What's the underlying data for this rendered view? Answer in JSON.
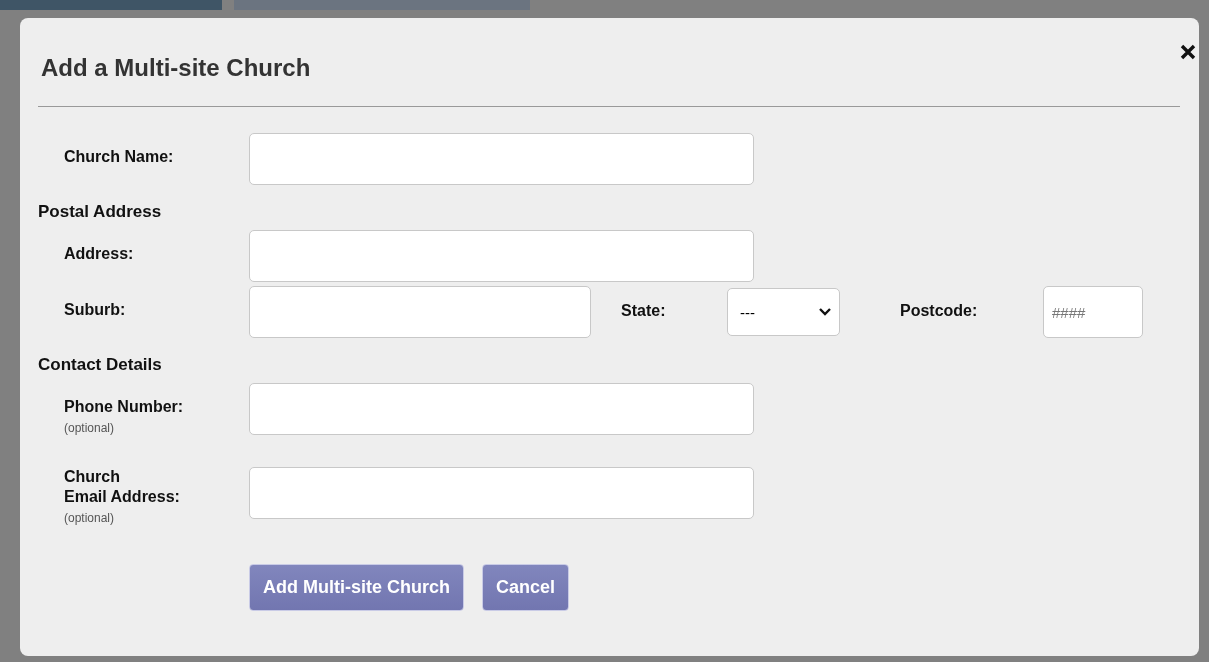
{
  "dialog": {
    "title": "Add a Multi-site Church"
  },
  "rows": [
    {
      "kind": "text",
      "label_lines": [
        "Church Name:"
      ]
    },
    {
      "kind": "heading",
      "text": "Postal Address"
    },
    {
      "kind": "text",
      "label_lines": [
        "Address:"
      ]
    },
    {
      "kind": "inline",
      "items": [
        {
          "kind": "text",
          "label_lines": [
            "Suburb:"
          ]
        },
        {
          "kind": "select",
          "label_lines": [
            "State:"
          ],
          "value": "---"
        },
        {
          "kind": "text",
          "label_lines": [
            "Postcode:"
          ],
          "placeholder": "####"
        }
      ]
    },
    {
      "kind": "heading",
      "text": "Contact Details"
    },
    {
      "kind": "text",
      "label_lines": [
        "Phone Number:"
      ],
      "note": "(optional)"
    },
    {
      "kind": "text",
      "label_lines": [
        "Church",
        "Email Address:"
      ],
      "note": "(optional)"
    }
  ],
  "buttons": [
    {
      "label": "Add Multi-site Church"
    },
    {
      "label": "Cancel"
    }
  ]
}
